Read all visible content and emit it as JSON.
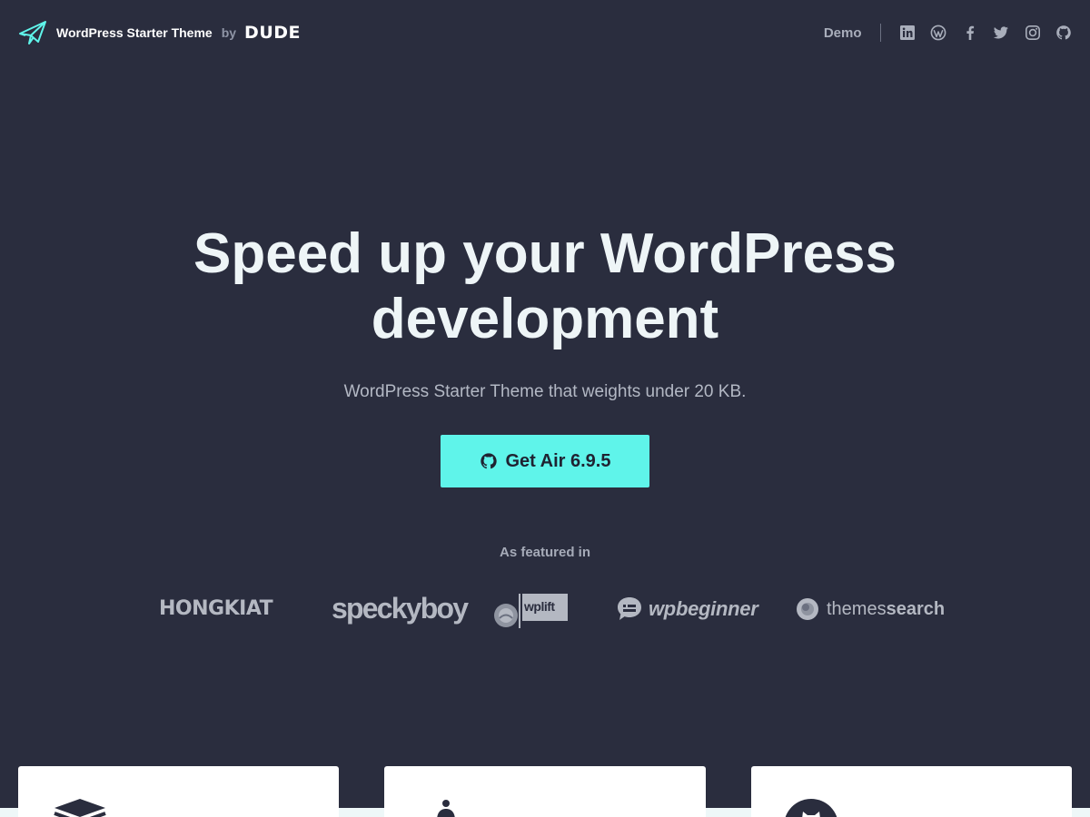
{
  "header": {
    "brand_name": "WordPress Starter Theme",
    "brand_by": "by",
    "brand_company": "DUDE",
    "nav_demo": "Demo",
    "social_icons": [
      "linkedin-icon",
      "wordpress-icon",
      "facebook-icon",
      "twitter-icon",
      "instagram-icon",
      "github-icon"
    ]
  },
  "hero": {
    "title_line1": "Speed up your WordPress",
    "title_line2": "development",
    "subtitle": "WordPress Starter Theme that weights under 20 KB.",
    "cta_label": "Get Air 6.9.5"
  },
  "featured": {
    "label": "As featured in",
    "logos": {
      "hongkiat": "HONGKIAT",
      "speckyboy": "speckyboy",
      "wplift": "wplift",
      "wpbeginner": "wpbeginner",
      "themessearch_light": "themes",
      "themessearch_bold": "search"
    }
  },
  "colors": {
    "background": "#2a2d3e",
    "accent": "#5ff4ea",
    "text_light": "#eef5f7",
    "text_muted": "#a9aebb"
  }
}
